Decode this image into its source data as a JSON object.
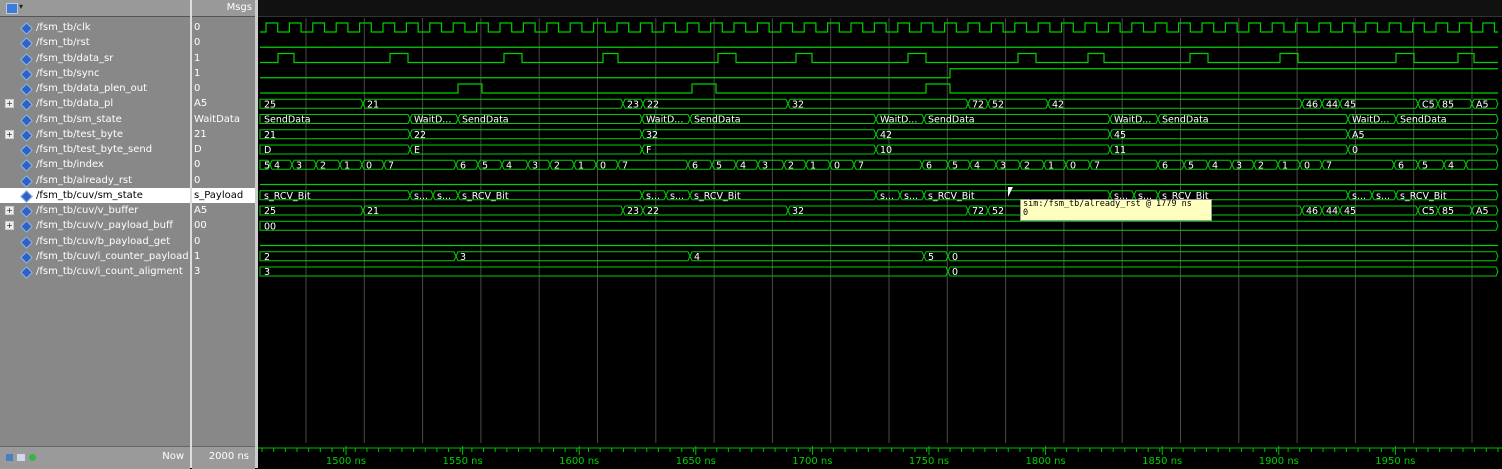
{
  "header": {
    "msgs_label": "Msgs"
  },
  "signals": [
    {
      "name": "/fsm_tb/clk",
      "value": "0",
      "expandable": false
    },
    {
      "name": "/fsm_tb/rst",
      "value": "0",
      "expandable": false
    },
    {
      "name": "/fsm_tb/data_sr",
      "value": "1",
      "expandable": false
    },
    {
      "name": "/fsm_tb/sync",
      "value": "1",
      "expandable": false
    },
    {
      "name": "/fsm_tb/data_plen_out",
      "value": "0",
      "expandable": false
    },
    {
      "name": "/fsm_tb/data_pl",
      "value": "A5",
      "expandable": true
    },
    {
      "name": "/fsm_tb/sm_state",
      "value": "WaitData",
      "expandable": false
    },
    {
      "name": "/fsm_tb/test_byte",
      "value": "21",
      "expandable": true
    },
    {
      "name": "/fsm_tb/test_byte_send",
      "value": "D",
      "expandable": false
    },
    {
      "name": "/fsm_tb/index",
      "value": "0",
      "expandable": false
    },
    {
      "name": "/fsm_tb/already_rst",
      "value": "0",
      "expandable": false
    },
    {
      "name": "/fsm_tb/cuv/sm_state",
      "value": "s_Payload",
      "expandable": false,
      "selected": true
    },
    {
      "name": "/fsm_tb/cuv/v_buffer",
      "value": "A5",
      "expandable": true
    },
    {
      "name": "/fsm_tb/cuv/v_payload_buff",
      "value": "00",
      "expandable": true
    },
    {
      "name": "/fsm_tb/cuv/b_payload_get",
      "value": "0",
      "expandable": false
    },
    {
      "name": "/fsm_tb/cuv/i_counter_payload",
      "value": "1",
      "expandable": false
    },
    {
      "name": "/fsm_tb/cuv/i_count_aligment",
      "value": "3",
      "expandable": false
    }
  ],
  "bus_labels": {
    "data_pl": [
      "25",
      "21",
      "23",
      "22",
      "32",
      "72",
      "52",
      "42",
      "46",
      "44",
      "45",
      "C5",
      "85",
      "A5"
    ],
    "sm_state": [
      "SendData",
      "WaitD...",
      "SendData",
      "WaitD...",
      "SendData",
      "WaitD...",
      "SendData",
      "WaitD...",
      "SendData",
      "WaitD...",
      "SendData"
    ],
    "test_byte": [
      "21",
      "22",
      "32",
      "42",
      "45",
      "A5"
    ],
    "test_byte_send": [
      "D",
      "E",
      "F",
      "10",
      "11",
      "0"
    ],
    "index": [
      "5",
      "4",
      "3",
      "2",
      "1",
      "0",
      "7",
      "6",
      "5",
      "4",
      "3",
      "2",
      "1",
      "0",
      "7",
      "6",
      "5",
      "4",
      "3",
      "2",
      "1",
      "0",
      "7",
      "6",
      "5",
      "4",
      "3",
      "2",
      "1",
      "0",
      "7",
      "6",
      "5",
      "4",
      "3",
      "2",
      "1",
      "0",
      "7",
      "6",
      "5",
      "4"
    ],
    "cuv_sm_state": [
      "s_RCV_Bit",
      "s...",
      "s...",
      "s_RCV_Bit",
      "s...",
      "s...",
      "s_RCV_Bit",
      "s...",
      "s...",
      "s_RCV_Bit",
      "s...",
      "s...",
      "s_RCV_Bit",
      "s...",
      "s...",
      "s_RCV_Bit"
    ],
    "v_buffer": [
      "25",
      "21",
      "23",
      "22",
      "32",
      "72",
      "52",
      "46",
      "44",
      "45",
      "C5",
      "85",
      "A5"
    ],
    "v_payload_buff": [
      "00"
    ],
    "i_counter_payload": [
      "2",
      "3",
      "4",
      "5",
      "0"
    ],
    "i_count_aligment": [
      "3",
      "0"
    ]
  },
  "tooltip": {
    "line1": "sim:/fsm_tb/already_rst @ 1779 ns",
    "line2": "0"
  },
  "timeline": {
    "now_label": "Now",
    "now_value": "2000 ns",
    "ticks": [
      "1500 ns",
      "1550 ns",
      "1600 ns",
      "1650 ns",
      "1700 ns",
      "1750 ns",
      "1800 ns",
      "1850 ns",
      "1900 ns",
      "1950 ns"
    ]
  },
  "colors": {
    "wave": "#00d000",
    "background": "#000000",
    "panel": "#888888",
    "selected_row": "#ffffff",
    "tooltip_bg": "#ffffc0"
  }
}
